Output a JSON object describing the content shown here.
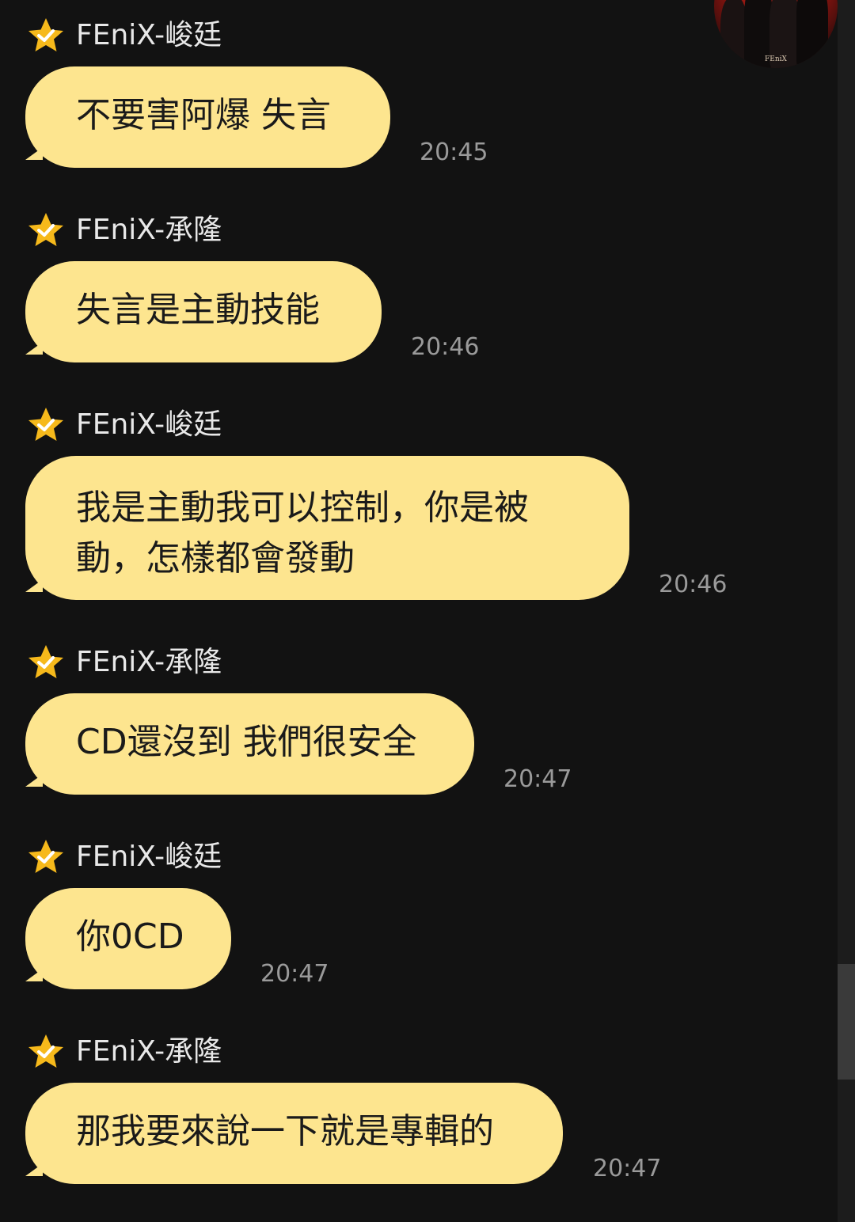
{
  "messages": [
    {
      "sender": "FEniX-峻廷",
      "text": "不要害阿爆 失言",
      "time": "20:45"
    },
    {
      "sender": "FEniX-承隆",
      "text": "失言是主動技能",
      "time": "20:46"
    },
    {
      "sender": "FEniX-峻廷",
      "text_line1": "我是主動我可以控制，你是被",
      "text_line2": "動，怎樣都會發動",
      "time": "20:46"
    },
    {
      "sender": "FEniX-承隆",
      "text": "CD還沒到 我們很安全",
      "time": "20:47"
    },
    {
      "sender": "FEniX-峻廷",
      "text": "你0CD",
      "time": "20:47"
    },
    {
      "sender": "FEniX-承隆",
      "text": "那我要來說一下就是專輯的",
      "time": "20:47"
    }
  ],
  "avatar": {
    "logo_text": "FEniX"
  },
  "colors": {
    "background": "#121212",
    "bubble": "#fde58f",
    "sender_text": "#e8e8e8",
    "time_text": "#9a9a9a",
    "star": "#f6b91b"
  },
  "icons": {
    "verified_star": "star-check-icon"
  }
}
